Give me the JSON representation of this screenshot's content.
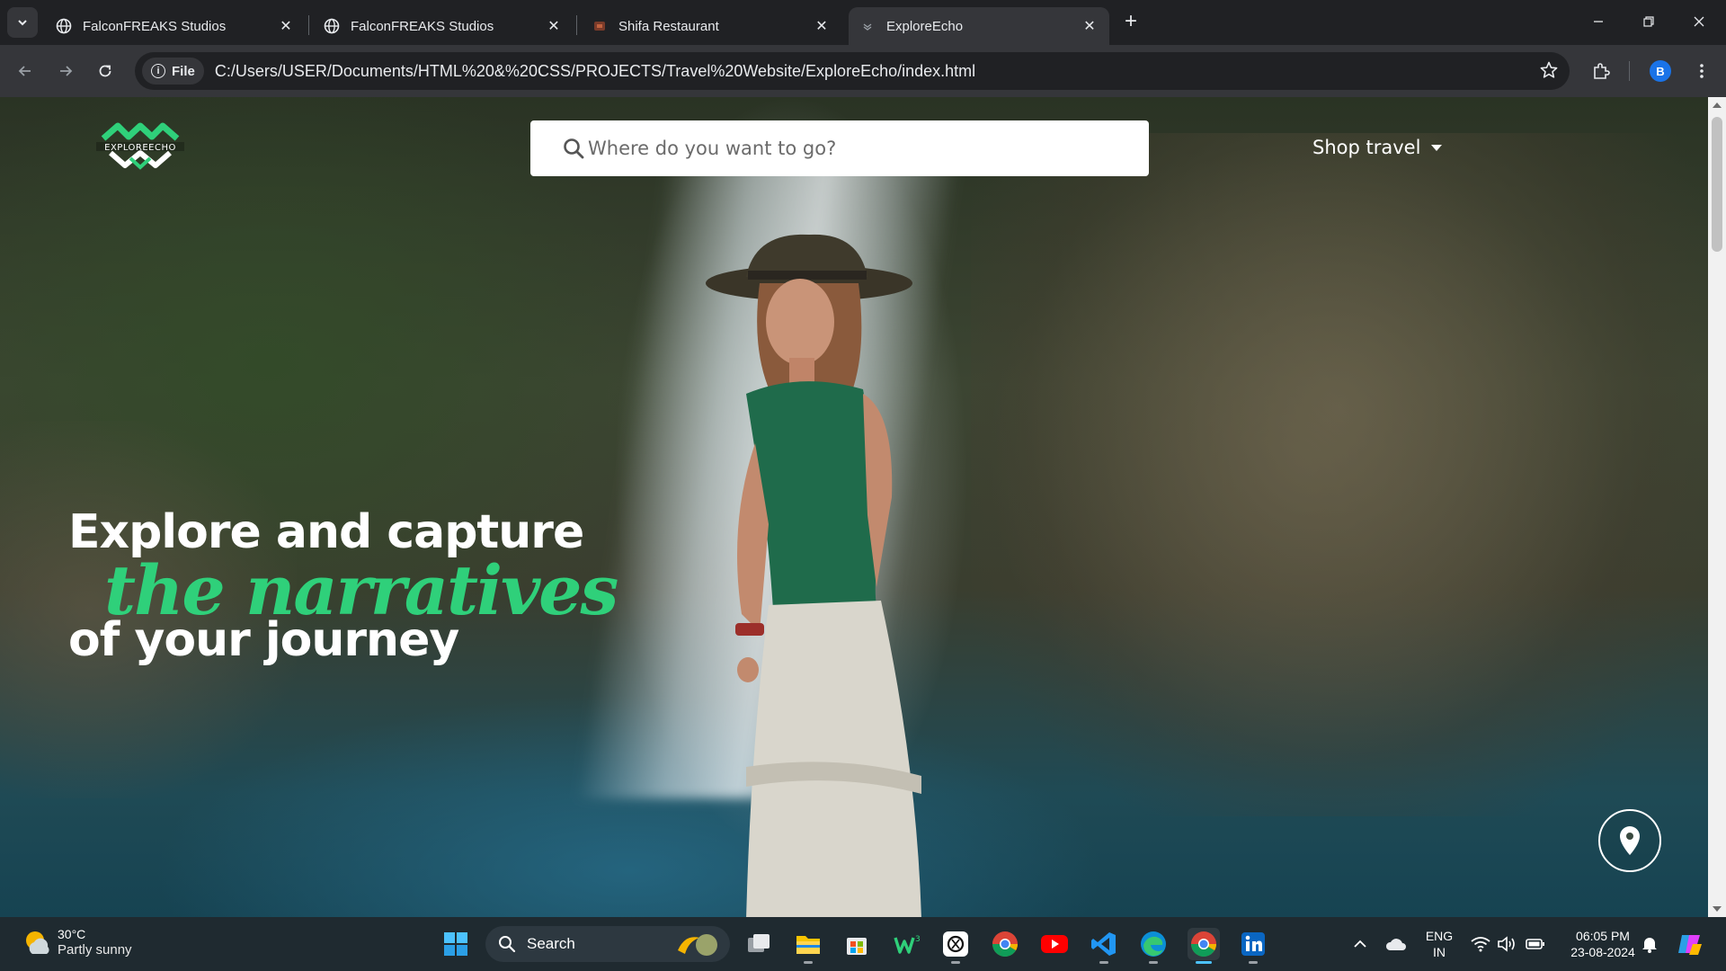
{
  "browser": {
    "tabs": [
      {
        "title": "FalconFREAKS Studios",
        "active": false,
        "favicon": "globe-icon"
      },
      {
        "title": "FalconFREAKS Studios",
        "active": false,
        "favicon": "globe-icon"
      },
      {
        "title": "Shifa Restaurant",
        "active": false,
        "favicon": "restaurant-icon"
      },
      {
        "title": "ExploreEcho",
        "active": true,
        "favicon": "page-icon"
      }
    ],
    "file_chip": "File",
    "url": "C:/Users/USER/Documents/HTML%20&%20CSS/PROJECTS/Travel%20Website/ExploreEcho/index.html",
    "profile_initial": "B"
  },
  "page": {
    "logo_text": "EXPLOREECHO",
    "search_placeholder": "Where do you want to go?",
    "shop_label": "Shop travel",
    "headline": {
      "line1": "Explore and capture",
      "line2": "the narratives",
      "line3": "of your journey"
    },
    "accent_color": "#2fd07a"
  },
  "taskbar": {
    "weather_temp": "30°C",
    "weather_cond": "Partly sunny",
    "search_label": "Search",
    "lang_line1": "ENG",
    "lang_line2": "IN",
    "time": "06:05 PM",
    "date": "23-08-2024"
  }
}
